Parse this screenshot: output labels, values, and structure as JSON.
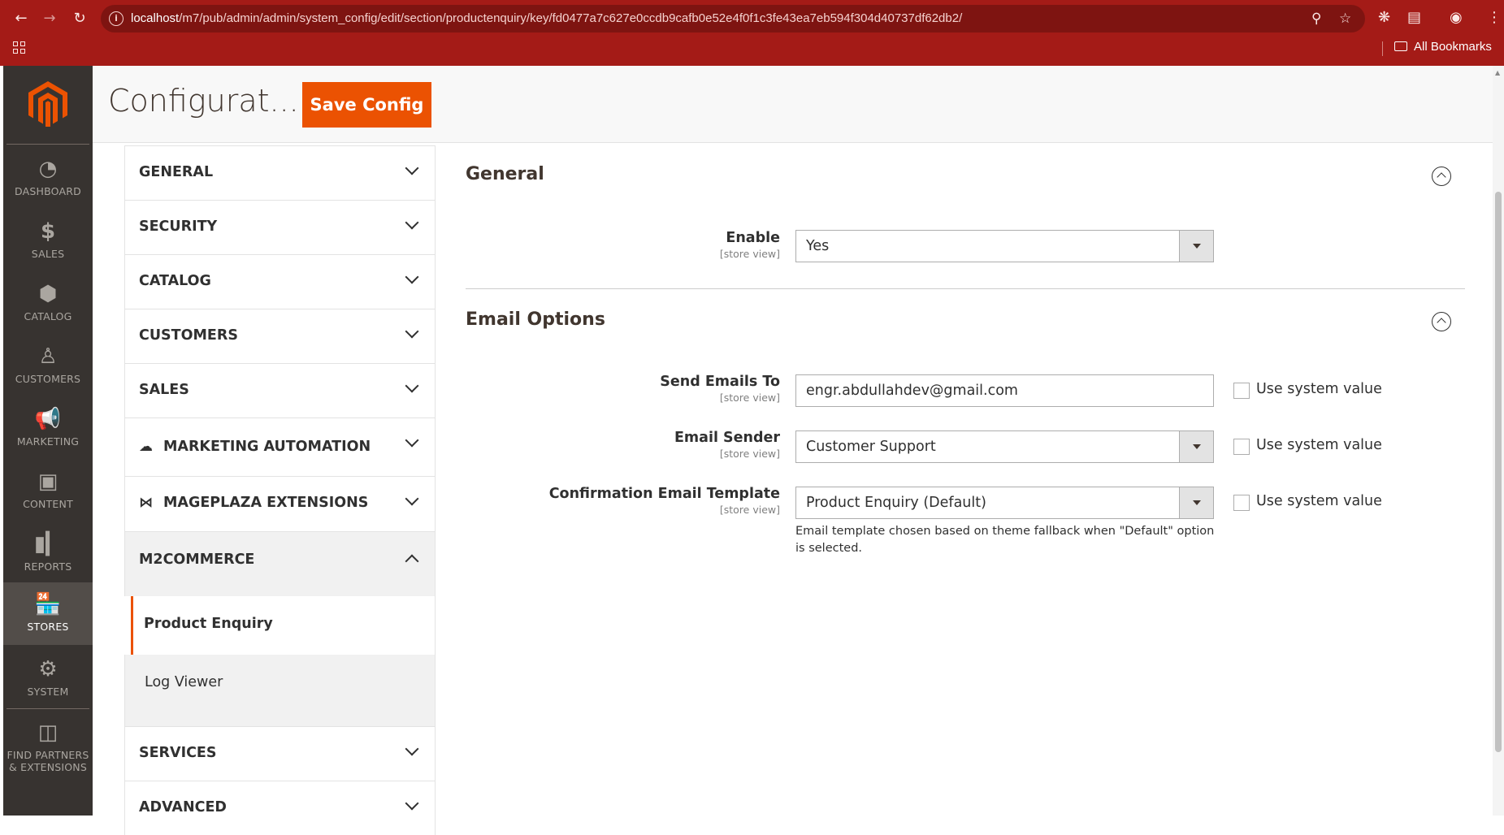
{
  "browser": {
    "url_host": "localhost",
    "url_path": "/m7/pub/admin/admin/system_config/edit/section/productenquiry/key/fd0477a7c627e0ccdb9cafb0e52e4f0f1c3fe43ea7eb594f304d40737df62db2/",
    "bookmarks_label": "All Bookmarks"
  },
  "admin_nav": {
    "items": [
      {
        "label": "DASHBOARD",
        "icon": "dashboard-icon"
      },
      {
        "label": "SALES",
        "icon": "dollar-icon"
      },
      {
        "label": "CATALOG",
        "icon": "box-icon"
      },
      {
        "label": "CUSTOMERS",
        "icon": "person-icon"
      },
      {
        "label": "MARKETING",
        "icon": "megaphone-icon"
      },
      {
        "label": "CONTENT",
        "icon": "layout-icon"
      },
      {
        "label": "REPORTS",
        "icon": "bar-chart-icon"
      },
      {
        "label": "STORES",
        "icon": "storefront-icon",
        "active": true
      },
      {
        "label": "SYSTEM",
        "icon": "gear-icon"
      },
      {
        "label": "FIND PARTNERS",
        "label2": "& EXTENSIONS",
        "icon": "cubes-icon"
      }
    ]
  },
  "header": {
    "title": "Configurat...",
    "save_label": "Save Config"
  },
  "tabs": {
    "general": "GENERAL",
    "security": "SECURITY",
    "catalog": "CATALOG",
    "customers": "CUSTOMERS",
    "sales": "SALES",
    "marketing_automation": "MARKETING AUTOMATION",
    "mageplaza": "MAGEPLAZA EXTENSIONS",
    "m2commerce": "M2COMMERCE",
    "m2commerce_items": [
      "Product Enquiry",
      "Log Viewer"
    ],
    "services": "SERVICES",
    "advanced": "ADVANCED"
  },
  "sections": {
    "general": {
      "title": "General",
      "enable_label": "Enable",
      "enable_scope": "[store view]",
      "enable_value": "Yes"
    },
    "email_options": {
      "title": "Email Options",
      "send_to_label": "Send Emails To",
      "send_to_scope": "[store view]",
      "send_to_value": "engr.abdullahdev@gmail.com",
      "sender_label": "Email Sender",
      "sender_scope": "[store view]",
      "sender_value": "Customer Support",
      "template_label": "Confirmation Email Template",
      "template_scope": "[store view]",
      "template_value": "Product Enquiry (Default)",
      "template_note": "Email template chosen based on theme fallback when \"Default\" option is selected.",
      "use_system_value": "Use system value"
    }
  },
  "colors": {
    "browser_bar": "#a41b17",
    "admin_nav": "#373330",
    "accent": "#eb5202"
  }
}
